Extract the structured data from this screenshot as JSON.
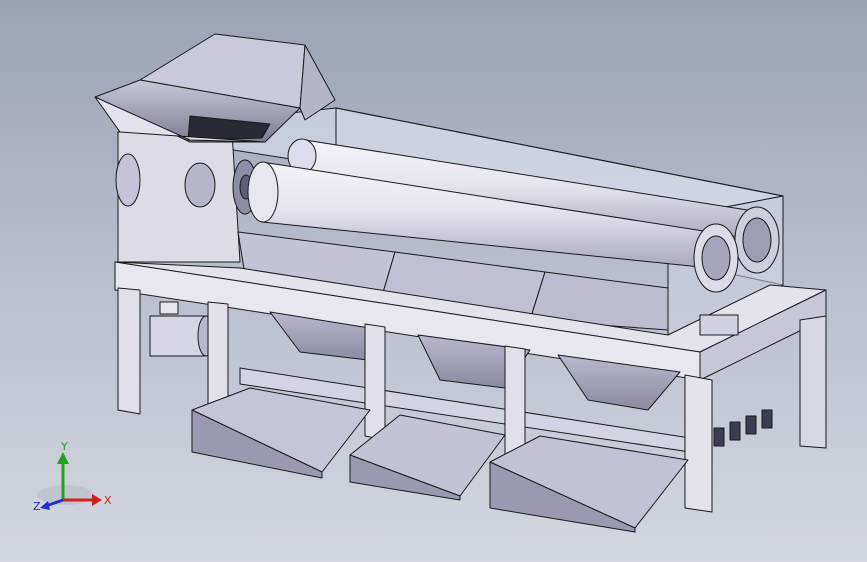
{
  "viewport": {
    "background_top": "#9aa2b4",
    "background_bottom": "#d4d7df"
  },
  "model": {
    "part_color": "#e6e4ee",
    "shadow_color": "#9c9cb2",
    "edge_color": "#1a1a1a",
    "glass_color": "#dfe5f0"
  },
  "triad": {
    "x_label": "X",
    "y_label": "Y",
    "z_label": "Z",
    "x_color": "#d22020",
    "y_color": "#20a020",
    "z_color": "#2030d0"
  }
}
